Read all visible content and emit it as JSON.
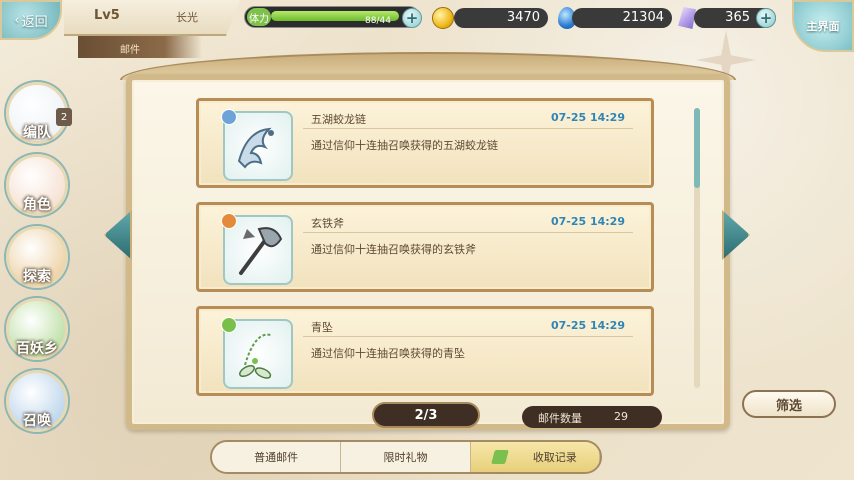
{
  "header": {
    "back_label": "返回",
    "level": "Lv5",
    "player_name": "长光",
    "section": "邮件",
    "stamina_label": "体力",
    "stamina_text": "88/44",
    "stamina_fraction": 1.0,
    "gold": "3470",
    "gems": "21304",
    "crystals": "365",
    "home_label": "主界面"
  },
  "sidebar": {
    "items": [
      {
        "label": "编队",
        "badge": "2",
        "color": "#e9eef3"
      },
      {
        "label": "角色",
        "color": "#f3d7c4"
      },
      {
        "label": "探索",
        "color": "#e8c58e"
      },
      {
        "label": "百妖乡",
        "color": "#a9d68a"
      },
      {
        "label": "召唤",
        "color": "#a9c9e6"
      }
    ]
  },
  "mails": [
    {
      "title": "五湖蛟龙链",
      "date": "07-25 14:29",
      "desc": "通过信仰十连抽召唤获得的五湖蛟龙链",
      "tag_color": "#6fa3d8",
      "icon": "dragon-chain-icon"
    },
    {
      "title": "玄铁斧",
      "date": "07-25 14:29",
      "desc": "通过信仰十连抽召唤获得的玄铁斧",
      "tag_color": "#e58a3a",
      "icon": "iron-axe-icon"
    },
    {
      "title": "青坠",
      "date": "07-25 14:29",
      "desc": "通过信仰十连抽召唤获得的青坠",
      "tag_color": "#79c04a",
      "icon": "green-pendant-icon"
    }
  ],
  "footer": {
    "page": "2/3",
    "count_label": "邮件数量",
    "count_value": "29",
    "filter_label": "筛选",
    "tabs": [
      "普通邮件",
      "限时礼物",
      "收取记录"
    ],
    "active_tab": 2
  }
}
